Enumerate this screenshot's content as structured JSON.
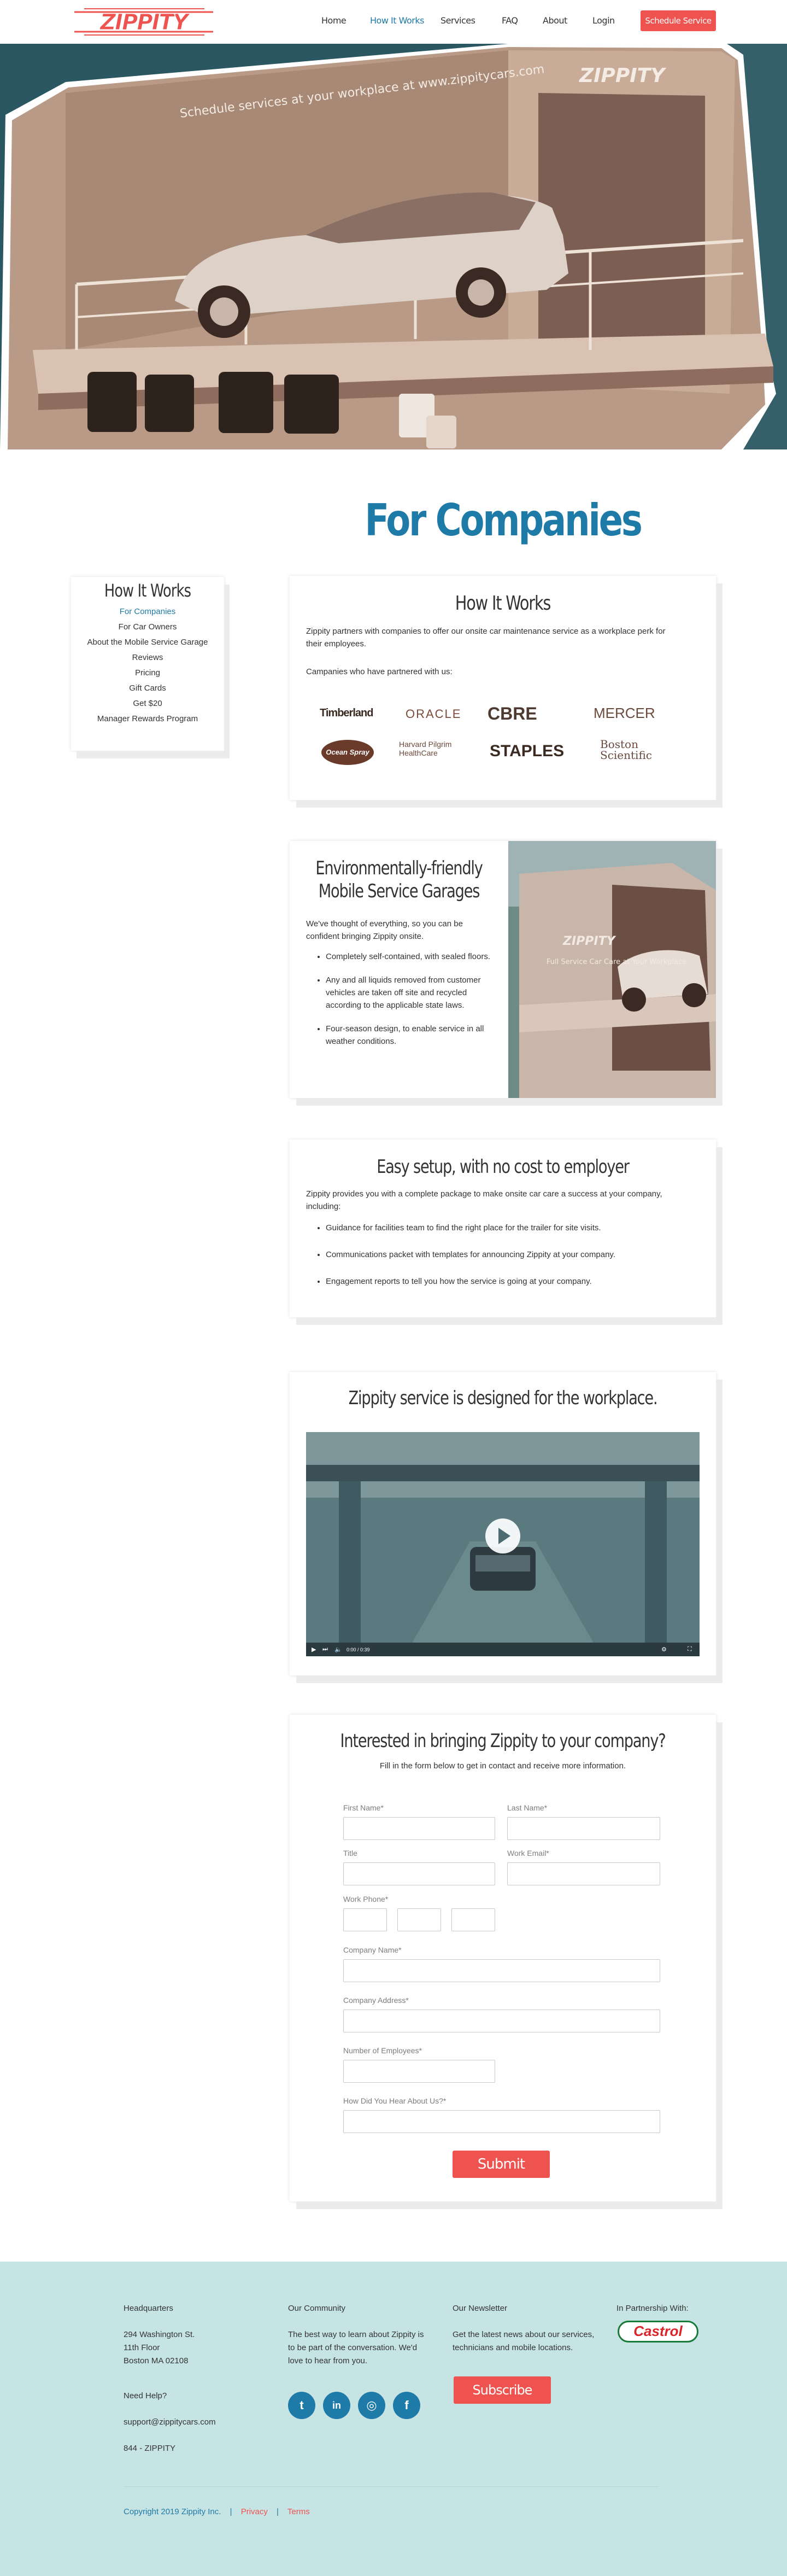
{
  "brand": {
    "logo_text": "ZIPPITY",
    "accent": "#ef5350",
    "link_blue": "#1e7aa6",
    "footer_bg": "#c7e4e4"
  },
  "nav": {
    "items": [
      {
        "label": "Home"
      },
      {
        "label": "How It Works"
      },
      {
        "label": "Services"
      },
      {
        "label": "FAQ"
      },
      {
        "label": "About"
      },
      {
        "label": "Login"
      }
    ],
    "cta": "Schedule Service"
  },
  "hero": {
    "trailer_text": "Schedule services at your workplace at www.zippitycars.com",
    "trailer_logo": "ZIPPITY"
  },
  "page_title": "For Companies",
  "sidebar": {
    "title": "How It Works",
    "items": [
      "For Companies",
      "For Car Owners",
      "About the Mobile Service Garage",
      "Reviews",
      "Pricing",
      "Gift Cards",
      "Get $20",
      "Manager Rewards Program"
    ]
  },
  "how_it_works": {
    "title": "How It Works",
    "intro": "Zippity partners with companies to offer our onsite car maintenance service as a workplace perk for their employees.",
    "partners_label": "Campanies who have partnered with us:",
    "partners": [
      "Timberland",
      "ORACLE",
      "CBRE",
      "MERCER",
      "Ocean Spray",
      "Harvard Pilgrim HealthCare",
      "STAPLES",
      "Boston Scientific"
    ]
  },
  "eco": {
    "title_line1": "Environmentally-friendly",
    "title_line2": "Mobile Service Garages",
    "intro": "We've thought of everything, so you can be confident bringing Zippity onsite.",
    "bullets": [
      "Completely self-contained, with sealed floors.",
      "Any and all liquids removed from customer vehicles are taken off site and recycled according to the applicable state laws.",
      "Four-season design, to enable service in all weather conditions."
    ],
    "image_text": "Full Service Car Care at Your Workplace",
    "image_logo": "ZIPPITY"
  },
  "setup": {
    "title": "Easy setup, with no cost to employer",
    "intro": "Zippity provides you with a complete package to make onsite car care a success at your company, including:",
    "bullets": [
      "Guidance for facilities team to find the right place for the trailer for site visits.",
      "Communications packet with templates for announcing Zippity at your company.",
      "Engagement reports to tell you how the service is going at your company."
    ]
  },
  "video": {
    "title": "Zippity service is designed for the workplace.",
    "time": "0:00 / 0:39"
  },
  "form": {
    "title": "Interested in bringing Zippity to your company?",
    "subtitle": "Fill in the form below to get in contact and receive more information.",
    "labels": {
      "first_name": "First Name*",
      "last_name": "Last Name*",
      "title": "Title",
      "work_email": "Work Email*",
      "work_phone": "Work Phone*",
      "company_name": "Company Name*",
      "company_address": "Company Address*",
      "num_employees": "Number of Employees*",
      "how_heard": "How Did You Hear About Us?*"
    },
    "submit": "Submit"
  },
  "footer": {
    "hq_title": "Headquarters",
    "address1": "294 Washington St.",
    "address2": "11th Floor",
    "address3": "Boston MA 02108",
    "help_title": "Need Help?",
    "email": "support@zippitycars.com",
    "phone": "844 - ZIPPITY",
    "community_title": "Our Community",
    "community_text": "The best way to learn about Zippity is to be part of the conversation. We'd love to hear from you.",
    "newsletter_title": "Our Newsletter",
    "newsletter_text": "Get the latest news about our services, technicians and mobile locations.",
    "subscribe": "Subscribe",
    "partner_title": "In Partnership With:",
    "partner_logo": "Castrol",
    "copyright": "Copyright 2019 Zippity Inc.",
    "sep": "|",
    "privacy": "Privacy",
    "terms": "Terms",
    "social": [
      {
        "icon": "twitter-icon",
        "glyph": "t"
      },
      {
        "icon": "linkedin-icon",
        "glyph": "in"
      },
      {
        "icon": "instagram-icon",
        "glyph": "◎"
      },
      {
        "icon": "facebook-icon",
        "glyph": "f"
      }
    ]
  }
}
